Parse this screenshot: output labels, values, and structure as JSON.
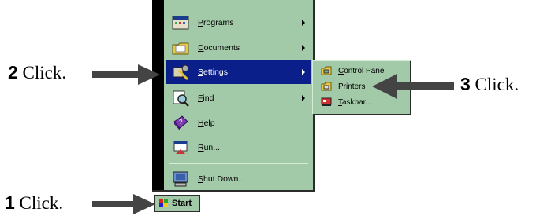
{
  "menu": {
    "items": [
      {
        "label": "Programs",
        "has_submenu": true
      },
      {
        "label": "Documents",
        "has_submenu": true
      },
      {
        "label": "Settings",
        "has_submenu": true,
        "active": true
      },
      {
        "label": "Find",
        "has_submenu": true
      },
      {
        "label": "Help",
        "has_submenu": false
      },
      {
        "label": "Run...",
        "has_submenu": false
      },
      {
        "label": "Shut Down...",
        "has_submenu": false
      }
    ],
    "highlight_color": "#0a1f8a",
    "background_color": "#a2c9a8"
  },
  "submenu": {
    "items": [
      {
        "label": "Control Panel"
      },
      {
        "label": "Printers"
      },
      {
        "label": "Taskbar..."
      }
    ]
  },
  "start_button": {
    "label": "Start"
  },
  "callouts": [
    {
      "step": "1",
      "text": " Click."
    },
    {
      "step": "2",
      "text": " Click."
    },
    {
      "step": "3",
      "text": " Click."
    }
  ]
}
